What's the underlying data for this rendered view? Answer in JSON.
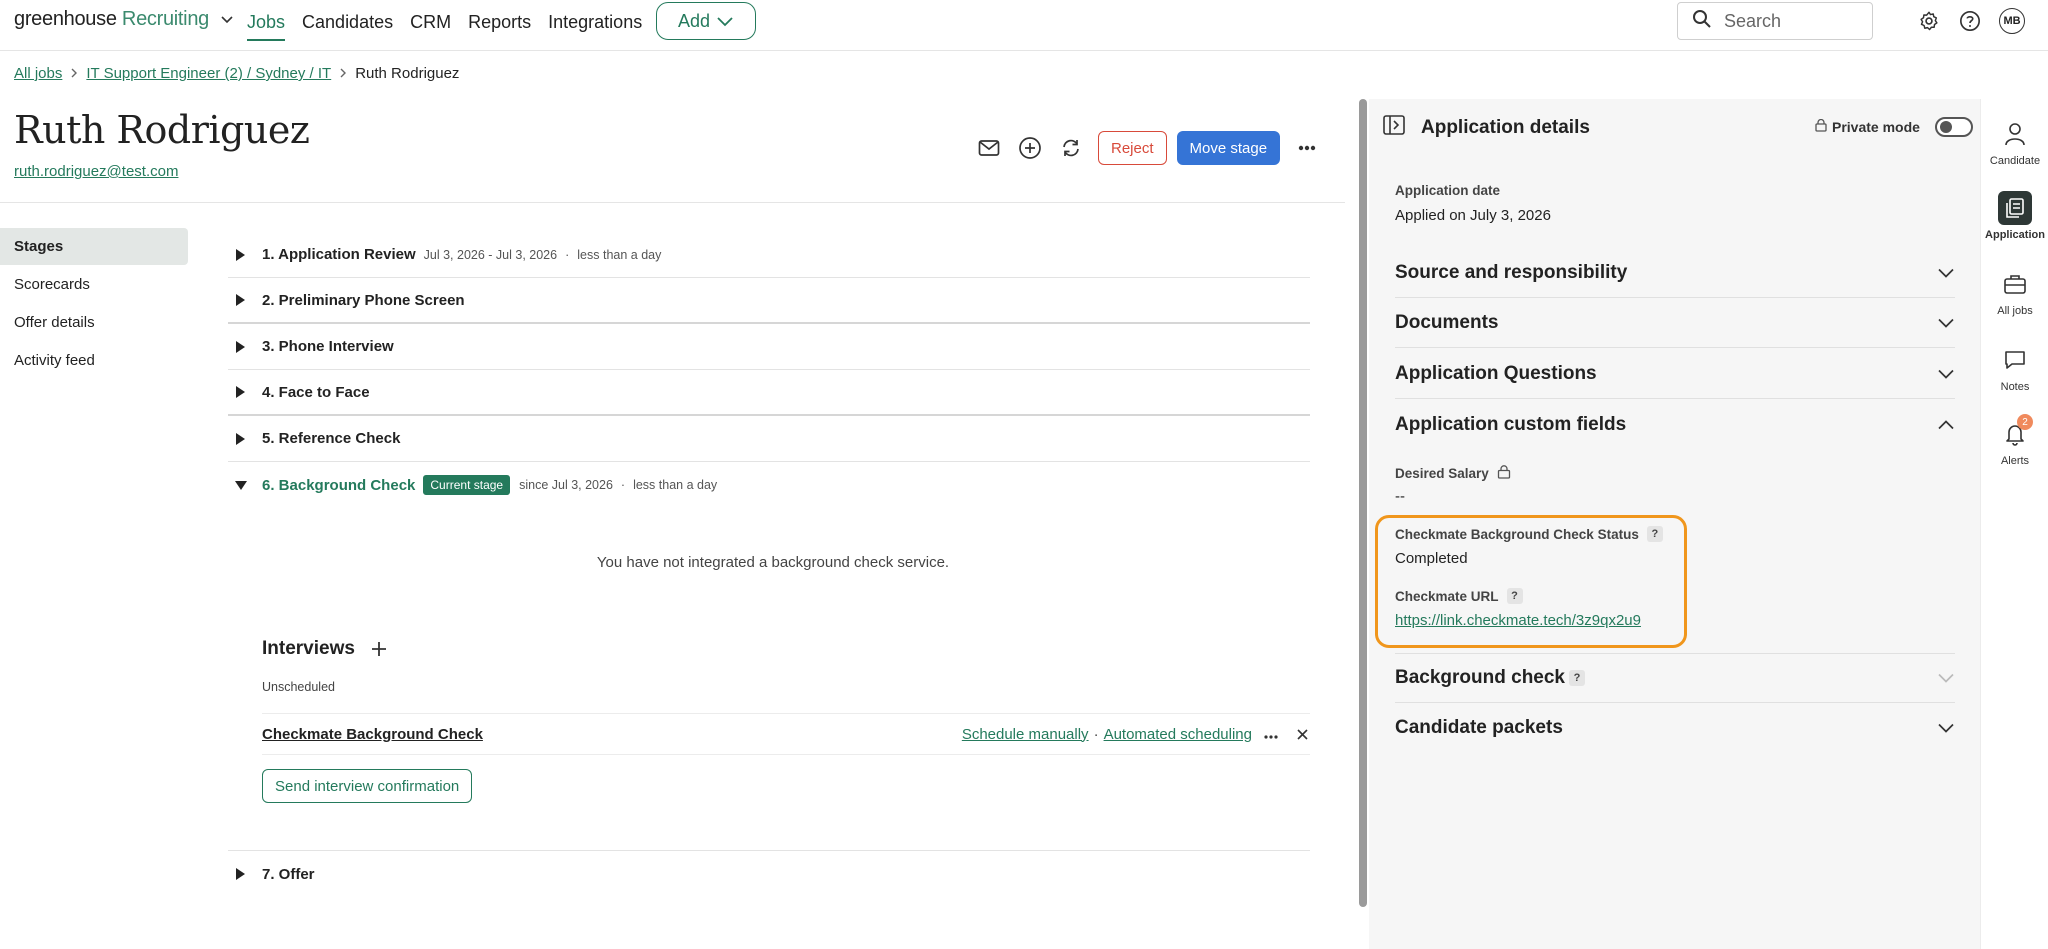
{
  "topnav": {
    "logo_brand": "greenhouse",
    "logo_product": "Recruiting",
    "links": [
      {
        "label": "Jobs",
        "active": true
      },
      {
        "label": "Candidates",
        "active": false
      },
      {
        "label": "CRM",
        "active": false
      },
      {
        "label": "Reports",
        "active": false
      },
      {
        "label": "Integrations",
        "active": false
      }
    ],
    "add_label": "Add",
    "search_placeholder": "Search",
    "avatar_initials": "MB"
  },
  "breadcrumb": {
    "items": [
      "All jobs",
      "IT Support Engineer (2) / Sydney / IT",
      "Ruth Rodriguez"
    ]
  },
  "candidate": {
    "name": "Ruth Rodriguez",
    "email": "ruth.rodriguez@test.com"
  },
  "actions": {
    "reject_label": "Reject",
    "move_label": "Move stage"
  },
  "leftnav": {
    "items": [
      {
        "label": "Stages",
        "active": true
      },
      {
        "label": "Scorecards",
        "active": false
      },
      {
        "label": "Offer details",
        "active": false
      },
      {
        "label": "Activity feed",
        "active": false
      }
    ]
  },
  "stages": [
    {
      "name": "1. Application Review",
      "dates": "Jul 3, 2026 - Jul 3, 2026",
      "duration": "less than a day"
    },
    {
      "name": "2. Preliminary Phone Screen"
    },
    {
      "name": "3. Phone Interview"
    },
    {
      "name": "4. Face to Face"
    },
    {
      "name": "5. Reference Check"
    },
    {
      "name": "6. Background Check",
      "badge": "Current stage",
      "dates": "since Jul 3, 2026",
      "duration": "less than a day"
    },
    {
      "name": "7. Offer"
    }
  ],
  "background_check": {
    "message": "You have not integrated a background check service.",
    "interviews_title": "Interviews",
    "unscheduled_label": "Unscheduled",
    "interview_name": "Checkmate Background Check",
    "schedule_manually": "Schedule manually",
    "separator": "·",
    "automated_scheduling": "Automated scheduling",
    "send_confirmation": "Send interview confirmation"
  },
  "panel": {
    "title": "Application details",
    "private_mode_label": "Private mode",
    "application_date_label": "Application date",
    "application_date_value": "Applied on July 3, 2026",
    "sections": {
      "source": "Source and responsibility",
      "documents": "Documents",
      "questions": "Application Questions",
      "custom_fields": "Application custom fields",
      "background_check": "Background check",
      "packets": "Candidate packets"
    },
    "desired_salary_label": "Desired Salary",
    "desired_salary_value": "--",
    "checkmate_status_label": "Checkmate Background Check Status",
    "checkmate_status_value": "Completed",
    "checkmate_url_label": "Checkmate URL",
    "checkmate_url_value": "https://link.checkmate.tech/3z9qx2u9"
  },
  "rail": {
    "items": [
      {
        "label": "Candidate",
        "active": false
      },
      {
        "label": "Application",
        "active": true
      },
      {
        "label": "All jobs",
        "active": false
      },
      {
        "label": "Notes",
        "active": false
      },
      {
        "label": "Alerts",
        "active": false,
        "badge": "2"
      }
    ]
  },
  "colors": {
    "brand_green": "#247a5c",
    "primary_blue": "#3574d6",
    "reject_red": "#d84a3a",
    "highlight_orange": "#f0961c",
    "alert_badge": "#f08a5d"
  }
}
